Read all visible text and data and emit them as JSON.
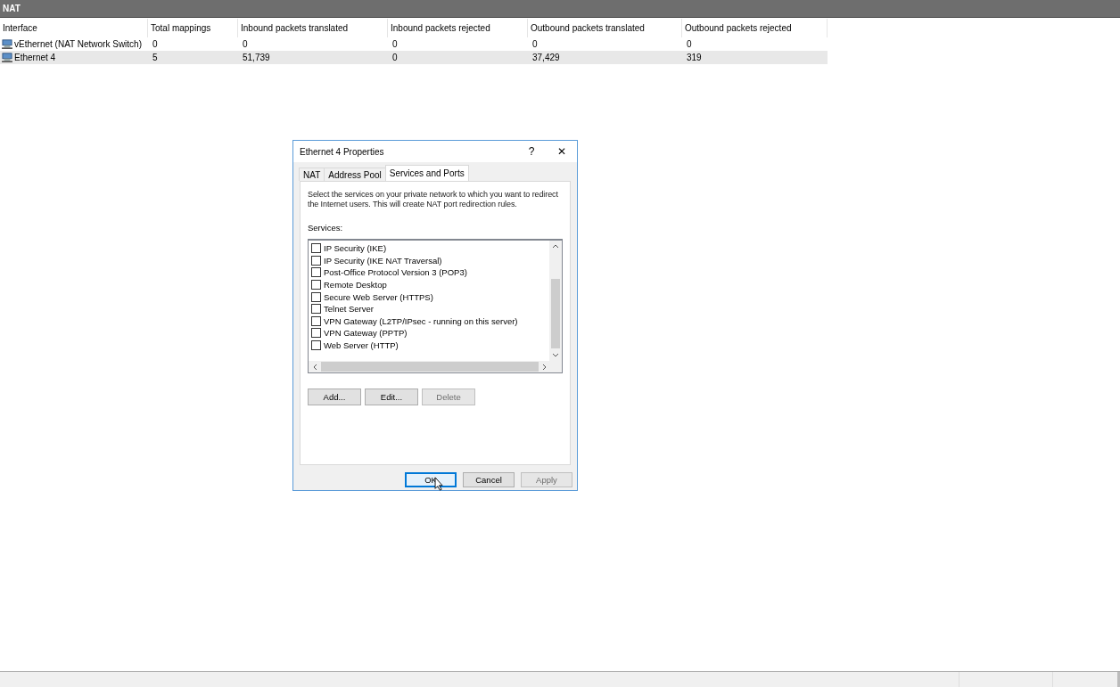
{
  "panel": {
    "title": "NAT"
  },
  "table": {
    "columns": [
      "Interface",
      "Total mappings",
      "Inbound packets translated",
      "Inbound packets rejected",
      "Outbound packets translated",
      "Outbound packets rejected"
    ],
    "rows": [
      {
        "selected": false,
        "cells": [
          "vEthernet (NAT Network Switch)",
          "0",
          "0",
          "0",
          "0",
          "0"
        ]
      },
      {
        "selected": true,
        "cells": [
          "Ethernet 4",
          "5",
          "51,739",
          "0",
          "37,429",
          "319"
        ]
      }
    ]
  },
  "dialog": {
    "title": "Ethernet 4 Properties",
    "help": "?",
    "close": "✕",
    "tabs": [
      {
        "label": "NAT",
        "selected": false
      },
      {
        "label": "Address Pool",
        "selected": false
      },
      {
        "label": "Services and Ports",
        "selected": true
      }
    ],
    "description": "Select the services on your private network to which you want to redirect the Internet users. This will create NAT port redirection rules.",
    "services_label": "Services:",
    "services": [
      {
        "label": "IP Security (IKE)",
        "checked": false
      },
      {
        "label": "IP Security (IKE NAT Traversal)",
        "checked": false
      },
      {
        "label": "Post-Office Protocol Version 3 (POP3)",
        "checked": false
      },
      {
        "label": "Remote Desktop",
        "checked": false
      },
      {
        "label": "Secure Web Server (HTTPS)",
        "checked": false
      },
      {
        "label": "Telnet Server",
        "checked": false
      },
      {
        "label": "VPN Gateway (L2TP/IPsec - running on this server)",
        "checked": false
      },
      {
        "label": "VPN Gateway (PPTP)",
        "checked": false
      },
      {
        "label": "Web Server (HTTP)",
        "checked": false
      }
    ],
    "list_buttons": [
      {
        "label": "Add...",
        "disabled": false
      },
      {
        "label": "Edit...",
        "disabled": false
      },
      {
        "label": "Delete",
        "disabled": true
      }
    ],
    "footer_buttons": [
      {
        "label": "OK",
        "disabled": false,
        "default": true
      },
      {
        "label": "Cancel",
        "disabled": false,
        "default": false
      },
      {
        "label": "Apply",
        "disabled": true,
        "default": false
      }
    ]
  }
}
